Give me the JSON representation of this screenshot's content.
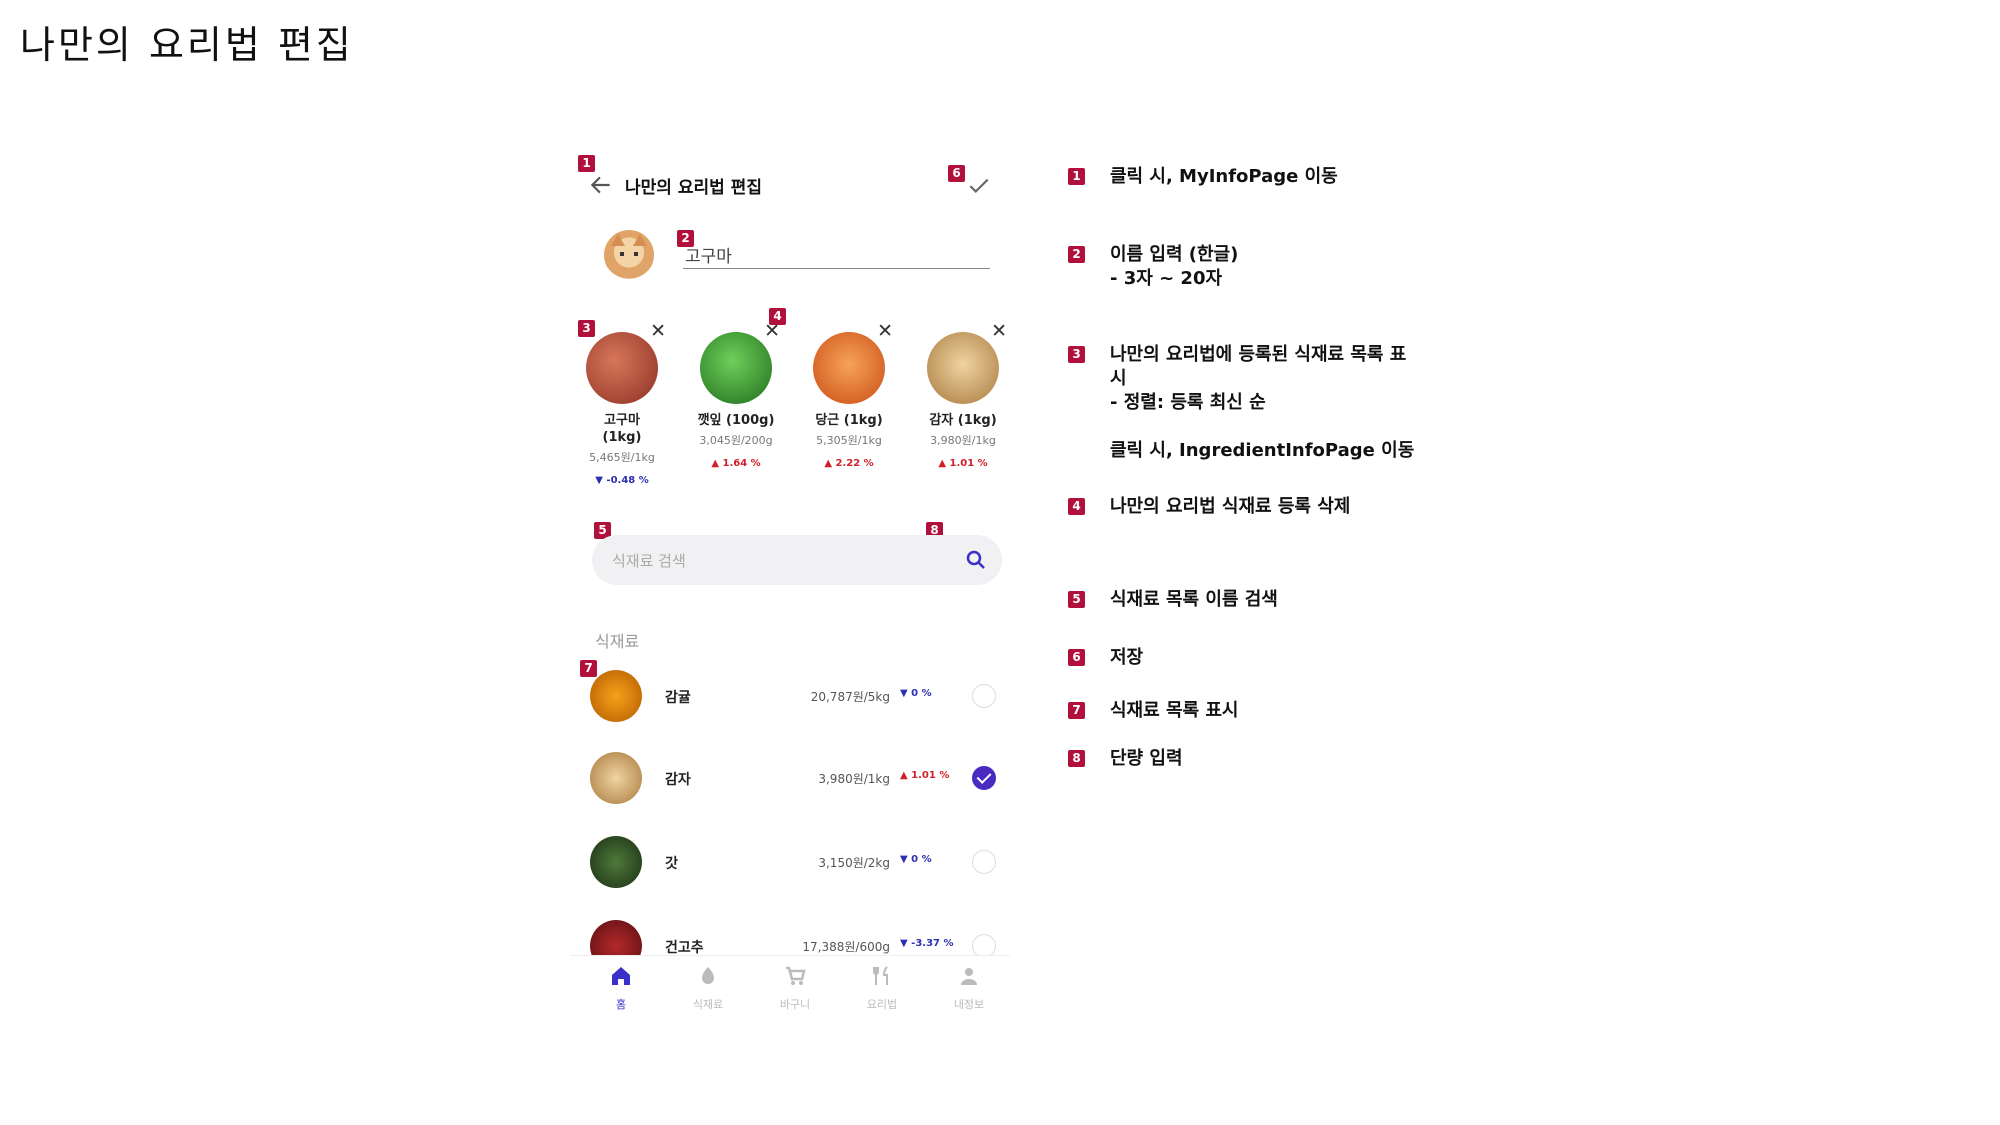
{
  "slide": {
    "title": "나만의 요리법 편집"
  },
  "app": {
    "title": "나만의 요리법 편집",
    "recipe_name": "고구마",
    "selected": [
      {
        "name": "고구마\n(1kg)",
        "price": "5,465원/1kg",
        "change": "▼ -0.48 %",
        "dir": "down",
        "img": "sweet-potato"
      },
      {
        "name": "깻잎 (100g)",
        "price": "3,045원/200g",
        "change": "▲ 1.64 %",
        "dir": "up",
        "img": "perilla-leaf"
      },
      {
        "name": "당근 (1kg)",
        "price": "5,305원/1kg",
        "change": "▲ 2.22 %",
        "dir": "up",
        "img": "carrot"
      },
      {
        "name": "감자 (1kg)",
        "price": "3,980원/1kg",
        "change": "▲ 1.01 %",
        "dir": "up",
        "img": "potato"
      }
    ],
    "search_placeholder": "식재료 검색",
    "section_label": "식재료",
    "list": [
      {
        "name": "감귤",
        "price": "20,787원/5kg",
        "change": "▼ 0 %",
        "dir": "down",
        "checked": false,
        "img": "tangerine"
      },
      {
        "name": "감자",
        "price": "3,980원/1kg",
        "change": "▲ 1.01 %",
        "dir": "up",
        "checked": true,
        "img": "potato"
      },
      {
        "name": "갓",
        "price": "3,150원/2kg",
        "change": "▼ 0 %",
        "dir": "down",
        "checked": false,
        "img": "mustard-greens"
      },
      {
        "name": "건고추",
        "price": "17,388원/600g",
        "change": "▼ -3.37 %",
        "dir": "down",
        "checked": false,
        "img": "dried-chili"
      }
    ],
    "nav": [
      {
        "label": "홈",
        "icon": "home-icon",
        "active": true
      },
      {
        "label": "식재료",
        "icon": "ingredient-icon",
        "active": false
      },
      {
        "label": "바구니",
        "icon": "cart-icon",
        "active": false
      },
      {
        "label": "요리법",
        "icon": "recipe-icon",
        "active": false
      },
      {
        "label": "내정보",
        "icon": "person-icon",
        "active": false
      }
    ]
  },
  "markers": [
    "1",
    "2",
    "3",
    "4",
    "5",
    "6",
    "7",
    "8"
  ],
  "notes": [
    {
      "num": "1",
      "text": "클릭 시, MyInfoPage 이동"
    },
    {
      "num": "2",
      "text": "이름 입력 (한글)\n- 3자 ~ 20자"
    },
    {
      "num": "3",
      "text": "나만의 요리법에 등록된 식재료 목록 표\n시\n- 정렬: 등록 최신 순\n\n클릭 시, IngredientInfoPage 이동"
    },
    {
      "num": "4",
      "text": "나만의 요리법 식재료 등록 삭제"
    },
    {
      "num": "5",
      "text": "식재료 목록 이름 검색"
    },
    {
      "num": "6",
      "text": "저장"
    },
    {
      "num": "7",
      "text": "식재료 목록 표시"
    },
    {
      "num": "8",
      "text": "단량 입력"
    }
  ],
  "colors": {
    "marker": "#b0103a",
    "accent": "#4a2bc2",
    "up": "#d11f2a",
    "down": "#2b2fb0"
  }
}
